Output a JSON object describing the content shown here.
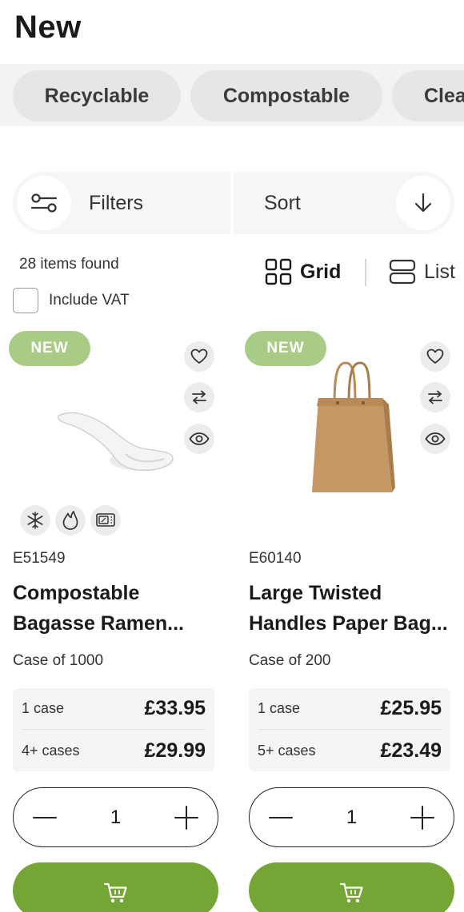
{
  "page": {
    "title": "New"
  },
  "categories": [
    "Recyclable",
    "Compostable",
    "Clea"
  ],
  "toolbar": {
    "filters_label": "Filters",
    "sort_label": "Sort"
  },
  "results": {
    "count_text": "28 items found",
    "vat_label": "Include VAT",
    "vat_checked": false
  },
  "view": {
    "grid_label": "Grid",
    "list_label": "List",
    "active": "grid"
  },
  "products": [
    {
      "badge": "NEW",
      "sku": "E51549",
      "name": "Compostable Bagasse Ramen...",
      "pack": "Case of 1000",
      "image_icon": "spoon-image",
      "features": [
        "snowflake-icon",
        "flame-icon",
        "microwave-icon"
      ],
      "prices": [
        {
          "qty": "1 case",
          "price": "£33.95"
        },
        {
          "qty": "4+ cases",
          "price": "£29.99"
        }
      ],
      "quantity": "1"
    },
    {
      "badge": "NEW",
      "sku": "E60140",
      "name": "Large Twisted Handles Paper Bag...",
      "pack": "Case of 200",
      "image_icon": "paper-bag-image",
      "features": [],
      "prices": [
        {
          "qty": "1 case",
          "price": "£25.95"
        },
        {
          "qty": "5+ cases",
          "price": "£23.49"
        }
      ],
      "quantity": "1"
    }
  ],
  "colors": {
    "accent_green": "#75a535",
    "badge_green": "#a8cb86",
    "chip_bg": "#e6e6e6"
  }
}
